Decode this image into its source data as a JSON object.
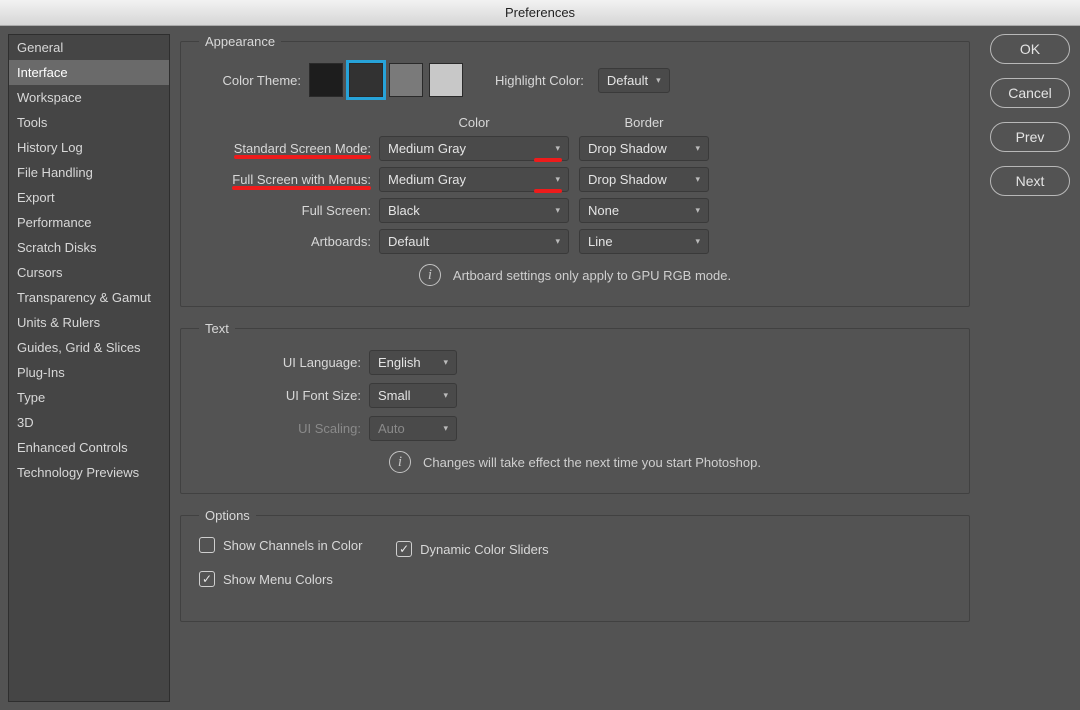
{
  "title": "Preferences",
  "sidebar": {
    "items": [
      {
        "label": "General"
      },
      {
        "label": "Interface",
        "selected": true
      },
      {
        "label": "Workspace"
      },
      {
        "label": "Tools"
      },
      {
        "label": "History Log"
      },
      {
        "label": "File Handling"
      },
      {
        "label": "Export"
      },
      {
        "label": "Performance"
      },
      {
        "label": "Scratch Disks"
      },
      {
        "label": "Cursors"
      },
      {
        "label": "Transparency & Gamut"
      },
      {
        "label": "Units & Rulers"
      },
      {
        "label": "Guides, Grid & Slices"
      },
      {
        "label": "Plug-Ins"
      },
      {
        "label": "Type"
      },
      {
        "label": "3D"
      },
      {
        "label": "Enhanced Controls"
      },
      {
        "label": "Technology Previews"
      }
    ]
  },
  "buttons": {
    "ok": "OK",
    "cancel": "Cancel",
    "prev": "Prev",
    "next": "Next"
  },
  "appearance": {
    "legend": "Appearance",
    "color_theme_label": "Color Theme:",
    "swatches": [
      "#1d1d1d",
      "#323232",
      "#7a7a7a",
      "#c8c8c8"
    ],
    "selected_swatch": 1,
    "highlight_color_label": "Highlight Color:",
    "highlight_color_value": "Default",
    "col_color": "Color",
    "col_border": "Border",
    "rows": [
      {
        "label": "Standard Screen Mode:",
        "color": "Medium Gray",
        "border": "Drop Shadow",
        "mark": true
      },
      {
        "label": "Full Screen with Menus:",
        "color": "Medium Gray",
        "border": "Drop Shadow",
        "mark": true
      },
      {
        "label": "Full Screen:",
        "color": "Black",
        "border": "None"
      },
      {
        "label": "Artboards:",
        "color": "Default",
        "border": "Line"
      }
    ],
    "info": "Artboard settings only apply to GPU RGB mode."
  },
  "text": {
    "legend": "Text",
    "ui_language_label": "UI Language:",
    "ui_language_value": "English",
    "ui_font_size_label": "UI Font Size:",
    "ui_font_size_value": "Small",
    "ui_scaling_label": "UI Scaling:",
    "ui_scaling_value": "Auto",
    "info": "Changes will take effect the next time you start Photoshop."
  },
  "options": {
    "legend": "Options",
    "show_channels": {
      "label": "Show Channels in Color",
      "checked": false
    },
    "dynamic_sliders": {
      "label": "Dynamic Color Sliders",
      "checked": true
    },
    "show_menu_colors": {
      "label": "Show Menu Colors",
      "checked": true
    }
  }
}
